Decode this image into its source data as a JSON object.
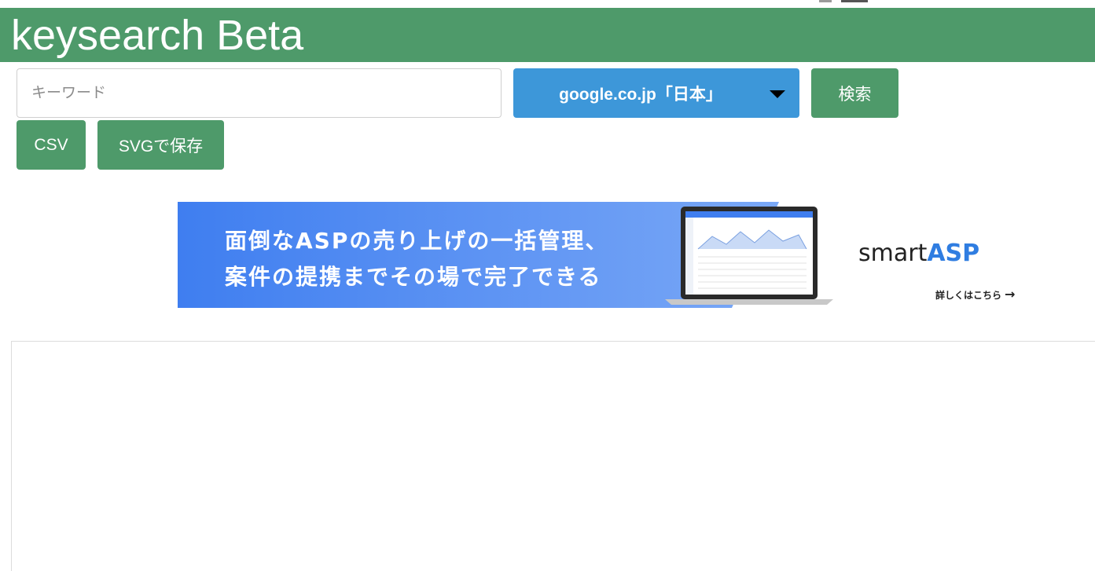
{
  "header": {
    "title": "keysearch Beta"
  },
  "search": {
    "placeholder": "キーワード",
    "domain_selected": "google.co.jp「日本」",
    "search_label": "検索"
  },
  "export": {
    "csv_label": "CSV",
    "svg_label": "SVGで保存"
  },
  "banner": {
    "line1": "面倒なASPの売り上げの一括管理、",
    "line2": "案件の提携までその場で完了できる",
    "brand_part1": "smart",
    "brand_part2": "ASP",
    "details_label": "詳しくはこちら",
    "arrow": "→"
  },
  "colors": {
    "header_bg": "#4e9a6a",
    "select_bg": "#3d97d9",
    "button_bg": "#4e9a6a",
    "brand_accent": "#2f7de1"
  }
}
